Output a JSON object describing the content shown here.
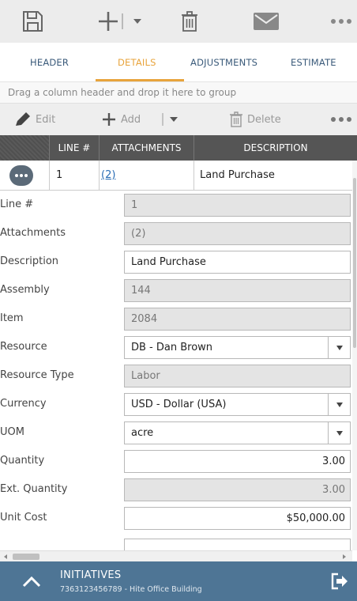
{
  "toolbar": {
    "icons": [
      "save-icon",
      "add-icon",
      "chevron-down-icon",
      "delete-icon",
      "mail-icon",
      "more-icon"
    ]
  },
  "tabs": [
    {
      "label": "HEADER"
    },
    {
      "label": "DETAILS",
      "active": true
    },
    {
      "label": "ADJUSTMENTS"
    },
    {
      "label": "ESTIMATE"
    }
  ],
  "group_bar": {
    "text": "Drag a column header and drop it here to group"
  },
  "grid_toolbar": {
    "edit_label": "Edit",
    "add_label": "Add",
    "delete_label": "Delete"
  },
  "columns": {
    "line": "LINE #",
    "attachments": "ATTACHMENTS",
    "description": "DESCRIPTION"
  },
  "row": {
    "line": "1",
    "attachments": "(2)",
    "description": "Land Purchase"
  },
  "form": {
    "line_label": "Line #",
    "line_value": "1",
    "attachments_label": "Attachments",
    "attachments_value": "(2)",
    "description_label": "Description",
    "description_value": "Land Purchase",
    "assembly_label": "Assembly",
    "assembly_value": "144",
    "item_label": "Item",
    "item_value": "2084",
    "resource_label": "Resource",
    "resource_value": "DB - Dan Brown",
    "resource_type_label": "Resource Type",
    "resource_type_value": "Labor",
    "currency_label": "Currency",
    "currency_value": "USD - Dollar (USA)",
    "uom_label": "UOM",
    "uom_value": "acre",
    "quantity_label": "Quantity",
    "quantity_value": "3.00",
    "ext_quantity_label": "Ext. Quantity",
    "ext_quantity_value": "3.00",
    "unit_cost_label": "Unit Cost",
    "unit_cost_value": "$50,000.00"
  },
  "bottom_bar": {
    "title": "INITIATIVES",
    "subtitle": "7363123456789 - Hite Office Building"
  },
  "colors": {
    "accent": "#e8a43c",
    "tab_text": "#3a5a7a",
    "header_bg": "#555555",
    "bottom_bar": "#4e7595"
  }
}
